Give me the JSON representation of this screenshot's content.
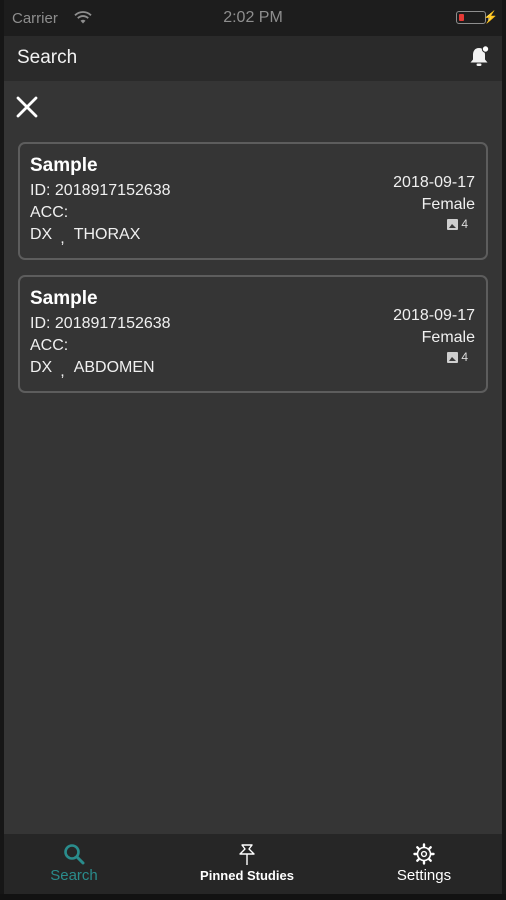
{
  "status_bar": {
    "carrier": "Carrier",
    "time": "2:02 PM"
  },
  "header": {
    "title": "Search"
  },
  "results": [
    {
      "name": "Sample",
      "id": "ID:  2018917152638",
      "acc": "ACC:",
      "modality": "DX",
      "body_part": "THORAX",
      "date": "2018-09-17",
      "gender": "Female",
      "image_count": "4"
    },
    {
      "name": "Sample",
      "id": "ID:  2018917152638",
      "acc": "ACC:",
      "modality": "DX",
      "body_part": "ABDOMEN",
      "date": "2018-09-17",
      "gender": "Female",
      "image_count": "4"
    }
  ],
  "tabs": [
    {
      "label": "Search",
      "icon": "search-icon",
      "active": true
    },
    {
      "label": "Pinned Studies",
      "icon": "pin-icon",
      "active": false
    },
    {
      "label": "Settings",
      "icon": "gear-icon",
      "active": false
    }
  ],
  "colors": {
    "accent": "#2a8c8c",
    "background": "#353535",
    "card_border": "#5d5d5d",
    "battery_low": "#e53935"
  }
}
